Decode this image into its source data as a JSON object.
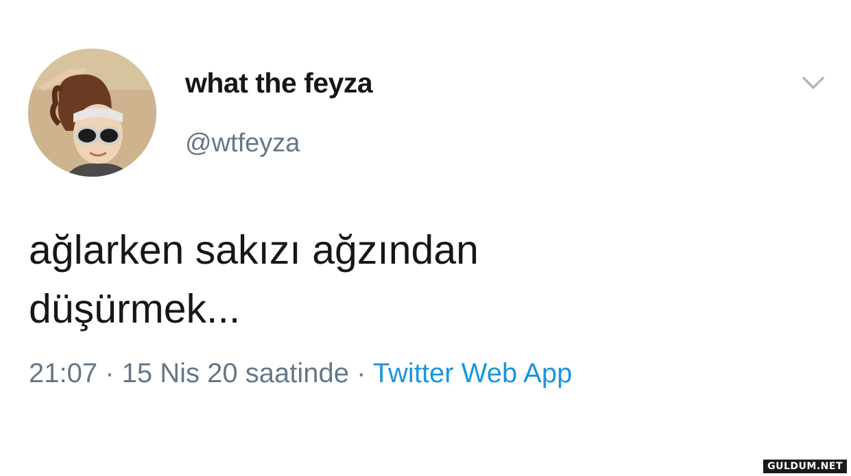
{
  "tweet": {
    "author": {
      "display_name": "what the feyza",
      "handle": "@wtfeyza",
      "avatar_icon": "profile-photo"
    },
    "menu_icon": "chevron-down-icon",
    "text_lines": [
      "ağlarken sakızı ağzından",
      "düşürmek..."
    ],
    "meta": {
      "time": "21:07",
      "separator": " · ",
      "date": "15 Nis 20 saatinde",
      "source": "Twitter Web App"
    }
  },
  "watermark": "GULDUM.NET",
  "colors": {
    "text_primary": "#14171a",
    "text_secondary": "#657786",
    "link": "#1b95e0",
    "chevron": "#aab8c2"
  }
}
